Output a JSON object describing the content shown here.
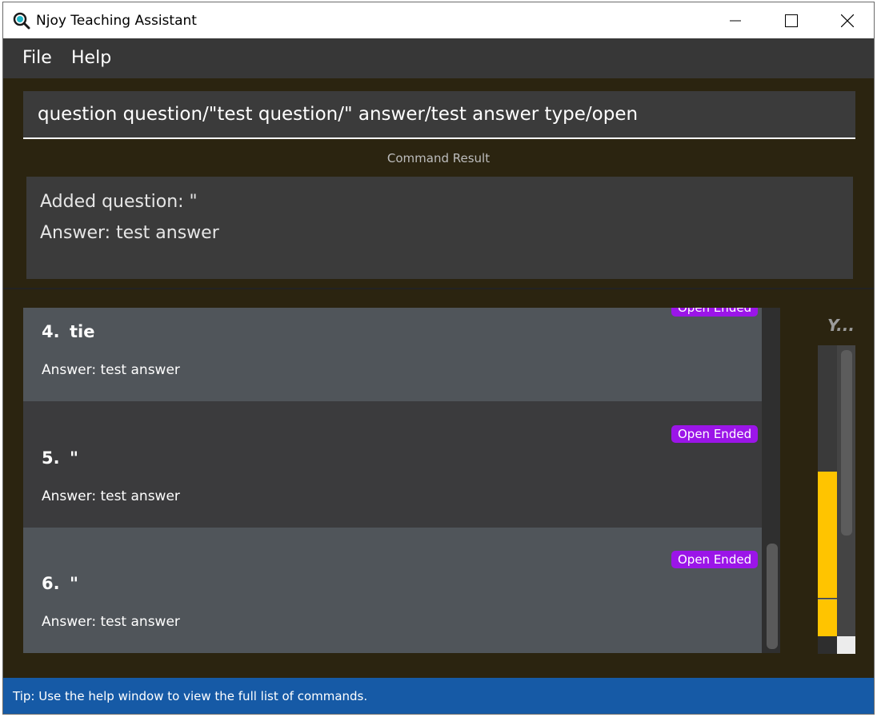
{
  "window": {
    "title": "Njoy Teaching Assistant",
    "controls": [
      "minimize-icon",
      "maximize-icon",
      "close-icon"
    ]
  },
  "menu": {
    "items": [
      {
        "label": "File"
      },
      {
        "label": "Help"
      }
    ]
  },
  "command": {
    "value": "question question/\"test question/\" answer/test answer type/open"
  },
  "result": {
    "label": "Command Result",
    "lines": [
      "Added question: \"",
      "Answer: test answer"
    ]
  },
  "questions": [
    {
      "index": "4.",
      "text": "tie",
      "answer": "Answer: test answer",
      "type": "Open Ended"
    },
    {
      "index": "5.",
      "text": "\"",
      "answer": "Answer: test answer",
      "type": "Open Ended"
    },
    {
      "index": "6.",
      "text": "\"",
      "answer": "Answer: test answer",
      "type": "Open Ended"
    }
  ],
  "side": {
    "title": "Y...",
    "progress_fraction": 0.43
  },
  "status": {
    "text": "Tip: Use the help window to view the full list of commands."
  },
  "colors": {
    "window_bg": "#2b2410",
    "menubar": "#373737",
    "badge": "#9b15e8",
    "accent_bar": "#ffc400",
    "statusbar": "#165aa6"
  }
}
